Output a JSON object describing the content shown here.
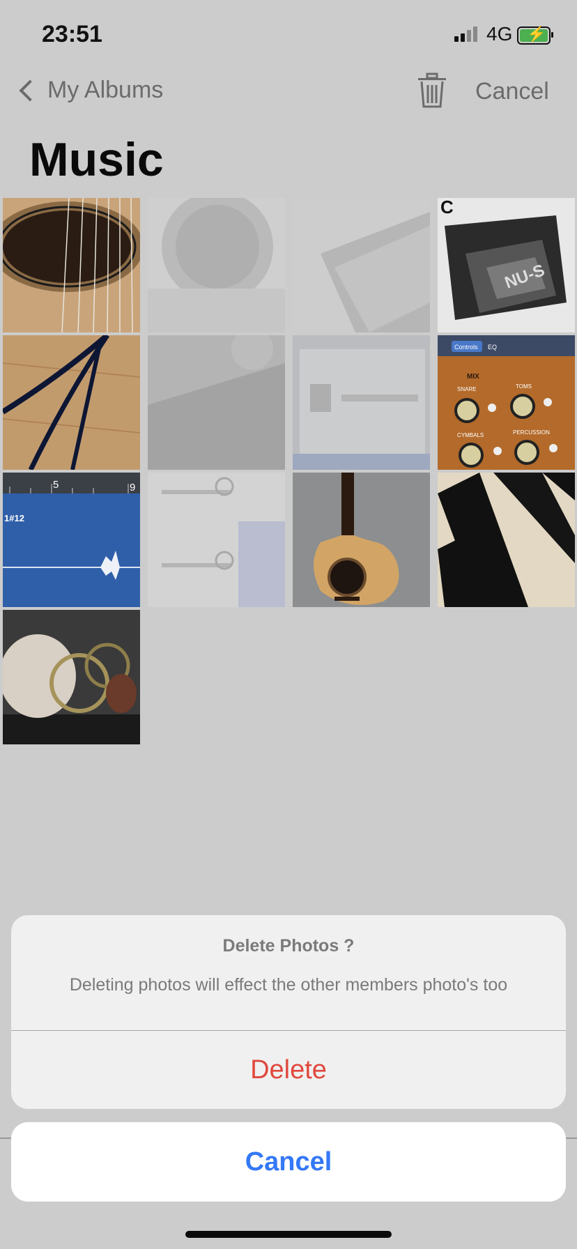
{
  "status_bar": {
    "time": "23:51",
    "network": "4G",
    "icons": [
      "signal-icon",
      "battery-charging-icon"
    ]
  },
  "nav": {
    "back_label": "My Albums",
    "cancel_label": "Cancel",
    "icons": [
      "chevron-left-icon",
      "trash-icon"
    ]
  },
  "album": {
    "title": "Music"
  },
  "grid": {
    "photos": [
      {
        "subject": "guitar-soundhole",
        "selected": true
      },
      {
        "subject": "microphone",
        "selected": false
      },
      {
        "subject": "pedal",
        "selected": false
      },
      {
        "subject": "pedal-close",
        "selected": true
      },
      {
        "subject": "cables",
        "selected": true
      },
      {
        "subject": "audio-interface",
        "selected": false
      },
      {
        "subject": "plugin-window",
        "selected": false
      },
      {
        "subject": "mixer-knobs",
        "selected": true
      },
      {
        "subject": "waveform",
        "selected": true
      },
      {
        "subject": "faders",
        "selected": false
      },
      {
        "subject": "acoustic-guitar",
        "selected": true
      },
      {
        "subject": "piano-keys",
        "selected": true
      },
      {
        "subject": "rattan-balls",
        "selected": true
      }
    ],
    "tile_text": {
      "mix": "MIX",
      "controls": "Controls",
      "eq": "EQ",
      "snare": "SNARE",
      "toms": "TOMS",
      "cymbals": "CYMBALS",
      "percussion": "PERCUSSION",
      "ruler_5": "5",
      "ruler_9": "9",
      "track": "1#12",
      "c_label": "C",
      "nu_s": "NU-S"
    }
  },
  "action_sheet": {
    "title": "Delete Photos ?",
    "message": "Deleting photos will effect the other members photo's too",
    "delete_label": "Delete",
    "cancel_label": "Cancel"
  },
  "colors": {
    "destructive": "#e0483d",
    "accent": "#3478f6",
    "overlay": "#cccccc"
  }
}
